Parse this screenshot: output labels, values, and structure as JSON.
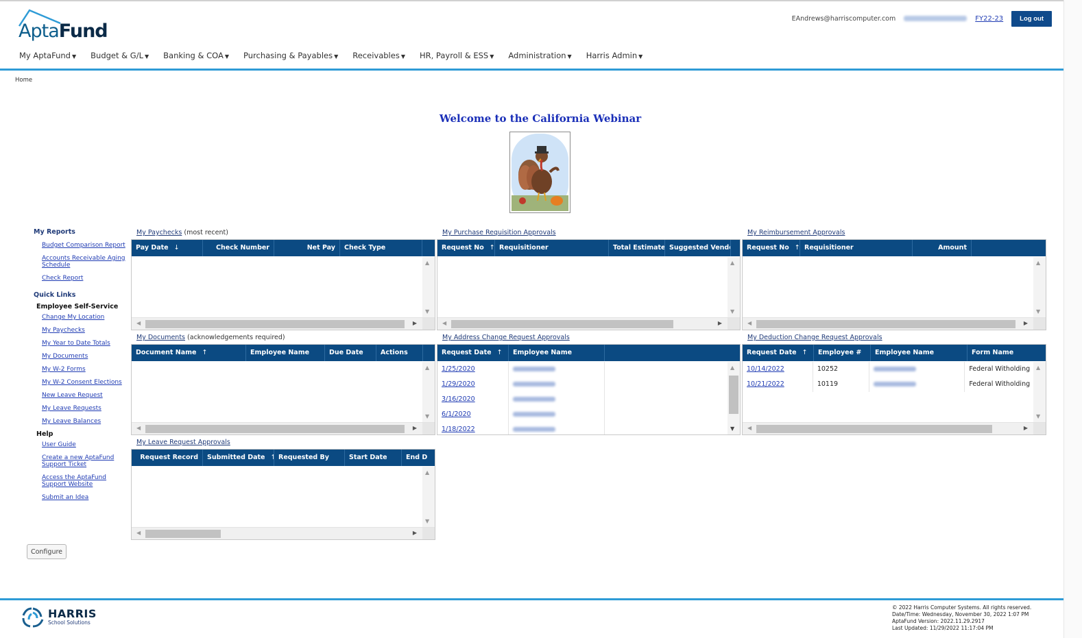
{
  "header": {
    "user_email": "EAndrews@harriscomputer.com",
    "fiscal_year": "FY22-23",
    "logout_label": "Log out",
    "logo_light": "Apta",
    "logo_bold": "Fund"
  },
  "nav": [
    "My AptaFund",
    "Budget & G/L",
    "Banking & COA",
    "Purchasing & Payables",
    "Receivables",
    "HR, Payroll & ESS",
    "Administration",
    "Harris Admin"
  ],
  "breadcrumb": "Home",
  "welcome": "Welcome to the California Webinar",
  "sidebar": {
    "reports_heading": "My Reports",
    "reports": [
      "Budget Comparison Report",
      "Accounts Receivable Aging Schedule",
      "Check Report"
    ],
    "quick_links_heading": "Quick Links",
    "ess_heading": "Employee Self-Service",
    "ess_links": [
      "Change My Location",
      "My Paychecks",
      "My Year to Date Totals",
      "My Documents",
      "My W-2 Forms",
      "My W-2 Consent Elections",
      "New Leave Request",
      "My Leave Requests",
      "My Leave Balances"
    ],
    "help_heading": "Help",
    "help_links": [
      "User Guide",
      "Create a new AptaFund Support Ticket",
      "Access the AptaFund Support Website",
      "Submit an Idea"
    ]
  },
  "configure_label": "Configure",
  "grids": {
    "paychecks": {
      "title": "My Paychecks",
      "note": "(most recent)",
      "columns": [
        "Pay Date",
        "Check Number",
        "Net Pay",
        "Check Type"
      ],
      "sort_glyph": "↓"
    },
    "requisitions": {
      "title": "My Purchase Requisition Approvals",
      "columns": [
        "Request No",
        "Requisitioner",
        "Total Estimate",
        "Suggested Vendor"
      ],
      "sort_glyph": "↑"
    },
    "reimbursements": {
      "title": "My Reimbursement Approvals",
      "columns": [
        "Request No",
        "Requisitioner",
        "Amount"
      ],
      "sort_glyph": "↑"
    },
    "documents": {
      "title": "My Documents",
      "note": "(acknowledgements required)",
      "columns": [
        "Document Name",
        "Employee Name",
        "Due Date",
        "Actions"
      ],
      "sort_glyph": "↑"
    },
    "address": {
      "title": "My Address Change Request Approvals",
      "columns": [
        "Request Date",
        "Employee Name"
      ],
      "sort_glyph": "↑",
      "rows": [
        "1/25/2020",
        "1/29/2020",
        "3/16/2020",
        "6/1/2020",
        "1/18/2022"
      ]
    },
    "deduction": {
      "title": "My Deduction Change Request Approvals",
      "columns": [
        "Request Date",
        "Employee #",
        "Employee Name",
        "Form Name"
      ],
      "sort_glyph": "↑",
      "rows": [
        {
          "date": "10/14/2022",
          "emp": "10252",
          "form": "Federal Witholding"
        },
        {
          "date": "10/21/2022",
          "emp": "10119",
          "form": "Federal Witholding"
        }
      ]
    },
    "leave": {
      "title": "My Leave Request Approvals",
      "columns": [
        "Request Record",
        "Submitted Date",
        "Requested By",
        "Start Date",
        "End D"
      ],
      "sort_glyph": "↑"
    }
  },
  "footer": {
    "brand": "HARRIS",
    "brand_sub": "School Solutions",
    "copyright": "© 2022 Harris Computer Systems. All rights reserved.",
    "datetime": "Date/Time: Wednesday, November 30, 2022 1:07 PM",
    "version": "AptaFund Version: 2022.11.29.2917",
    "updated": "Last Updated: 11/29/2022 11:17:04 PM"
  },
  "colors": {
    "header_blue": "#0b4a82",
    "rule_blue": "#2e9bd6",
    "link": "#1f3bb3",
    "welcome": "#1a2fb8"
  }
}
